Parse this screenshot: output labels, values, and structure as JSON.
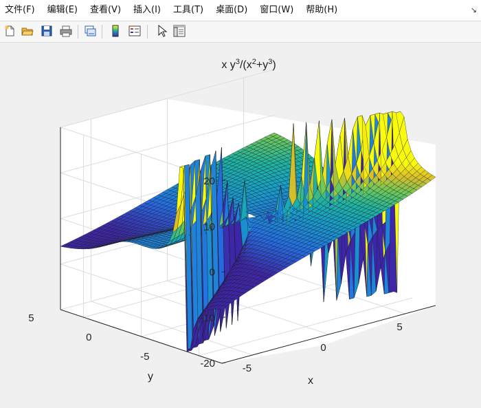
{
  "menubar": {
    "items": [
      "文件(F)",
      "编辑(E)",
      "查看(V)",
      "插入(I)",
      "工具(T)",
      "桌面(D)",
      "窗口(W)",
      "帮助(H)"
    ],
    "corner_icon": "dock-arrow-icon"
  },
  "toolbar": {
    "buttons": [
      "new-figure-icon",
      "open-file-icon",
      "save-icon",
      "print-icon",
      "link-plot-icon",
      "colorbar-icon",
      "legend-icon",
      "pointer-icon",
      "property-inspector-icon"
    ]
  },
  "plot": {
    "title_base": "x y",
    "title_exp1": "3",
    "title_mid": "/(x",
    "title_exp2": "2",
    "title_mid2": "+y",
    "title_exp3": "3",
    "title_end": ")",
    "xlabel": "x",
    "ylabel": "y"
  },
  "chart_data": {
    "type": "surface",
    "function": "x y^3/(x^2+y^3)",
    "xlabel": "x",
    "ylabel": "y",
    "zlabel": "",
    "xlim": [
      -7,
      7
    ],
    "ylim": [
      -7,
      7
    ],
    "zlim": [
      -20,
      20
    ],
    "xticks": [
      -5,
      0,
      5
    ],
    "yticks": [
      -5,
      0,
      5
    ],
    "zticks": [
      -20,
      -10,
      0,
      10,
      20
    ],
    "grid": true,
    "colormap": "parula",
    "colors": {
      "low": "#3e26a8",
      "mid": "#1fa8aa",
      "high": "#f9fb0e",
      "axes_bg": "#ffffff",
      "grid": "#dcdcdc"
    }
  }
}
